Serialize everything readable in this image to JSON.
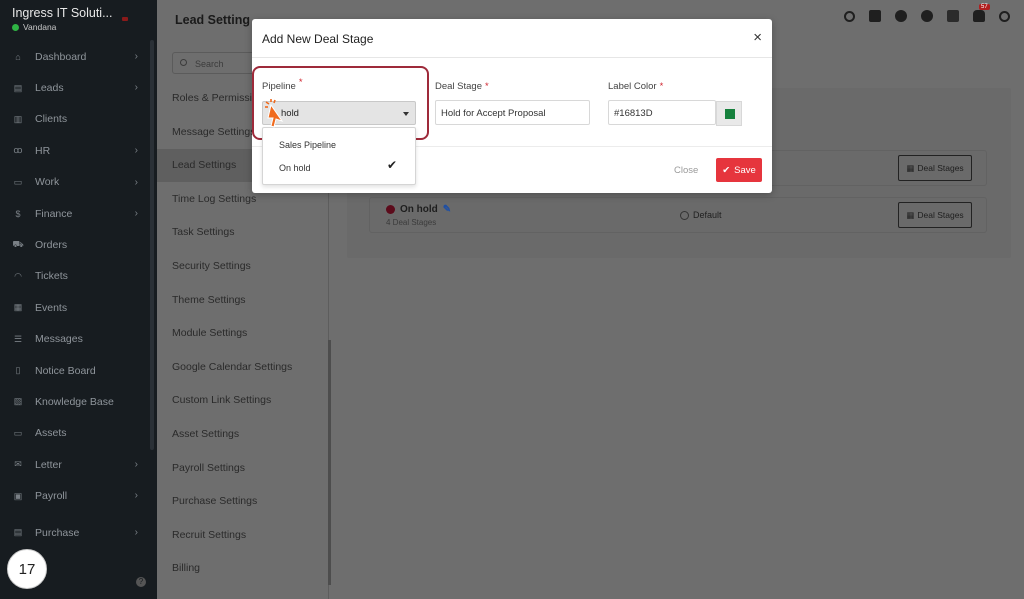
{
  "sidebar": {
    "company": "Ingress IT Soluti...",
    "user": "Vandana",
    "items": [
      {
        "label": "Dashboard",
        "icon": "home-icon",
        "chevron": true
      },
      {
        "label": "Leads",
        "icon": "id-card-icon",
        "chevron": true
      },
      {
        "label": "Clients",
        "icon": "chart-icon",
        "chevron": false
      },
      {
        "label": "HR",
        "icon": "people-icon",
        "chevron": true
      },
      {
        "label": "Work",
        "icon": "briefcase-icon",
        "chevron": true
      },
      {
        "label": "Finance",
        "icon": "dollar-icon",
        "chevron": true
      },
      {
        "label": "Orders",
        "icon": "cart-icon",
        "chevron": false
      },
      {
        "label": "Tickets",
        "icon": "headset-icon",
        "chevron": false
      },
      {
        "label": "Events",
        "icon": "calendar-icon",
        "chevron": false
      },
      {
        "label": "Messages",
        "icon": "message-icon",
        "chevron": false
      },
      {
        "label": "Notice Board",
        "icon": "clipboard-icon",
        "chevron": false
      },
      {
        "label": "Knowledge Base",
        "icon": "book-icon",
        "chevron": false
      },
      {
        "label": "Assets",
        "icon": "monitor-icon",
        "chevron": false
      },
      {
        "label": "Letter",
        "icon": "mail-icon",
        "chevron": true
      },
      {
        "label": "Payroll",
        "icon": "wallet-icon",
        "chevron": true
      },
      {
        "label": "Purchase",
        "icon": "receipt-icon",
        "chevron": true
      }
    ],
    "step_number": "17"
  },
  "topbar": {
    "title": "Lead Setting",
    "notification_count": "57"
  },
  "settings_menu": {
    "search_placeholder": "Search",
    "items": [
      "Roles & Permissio",
      "Message Settings",
      "Lead Settings",
      "Time Log Settings",
      "Task Settings",
      "Security Settings",
      "Theme Settings",
      "Module Settings",
      "Google Calendar Settings",
      "Custom Link Settings",
      "Asset Settings",
      "Payroll Settings",
      "Purchase Settings",
      "Recruit Settings",
      "Billing"
    ],
    "active_index": 2
  },
  "pipelines": [
    {
      "name": "",
      "sub": "",
      "default_label": "",
      "button": "Deal Stages"
    },
    {
      "name": "On hold",
      "sub": "4 Deal Stages",
      "default_label": "Default",
      "button": "Deal Stages"
    }
  ],
  "modal": {
    "title": "Add New Deal Stage",
    "pipeline_label": "Pipeline",
    "pipeline_value": "hold",
    "pipeline_options": [
      "Sales Pipeline",
      "On hold"
    ],
    "pipeline_selected": "On hold",
    "deal_stage_label": "Deal Stage",
    "deal_stage_value": "Hold for Accept Proposal",
    "label_color_label": "Label Color",
    "label_color_value": "#16813D",
    "close_label": "Close",
    "save_label": "Save"
  },
  "colors": {
    "accent_red": "#e6353d",
    "swatch": "#16813D",
    "highlight": "#9e2a3a"
  }
}
